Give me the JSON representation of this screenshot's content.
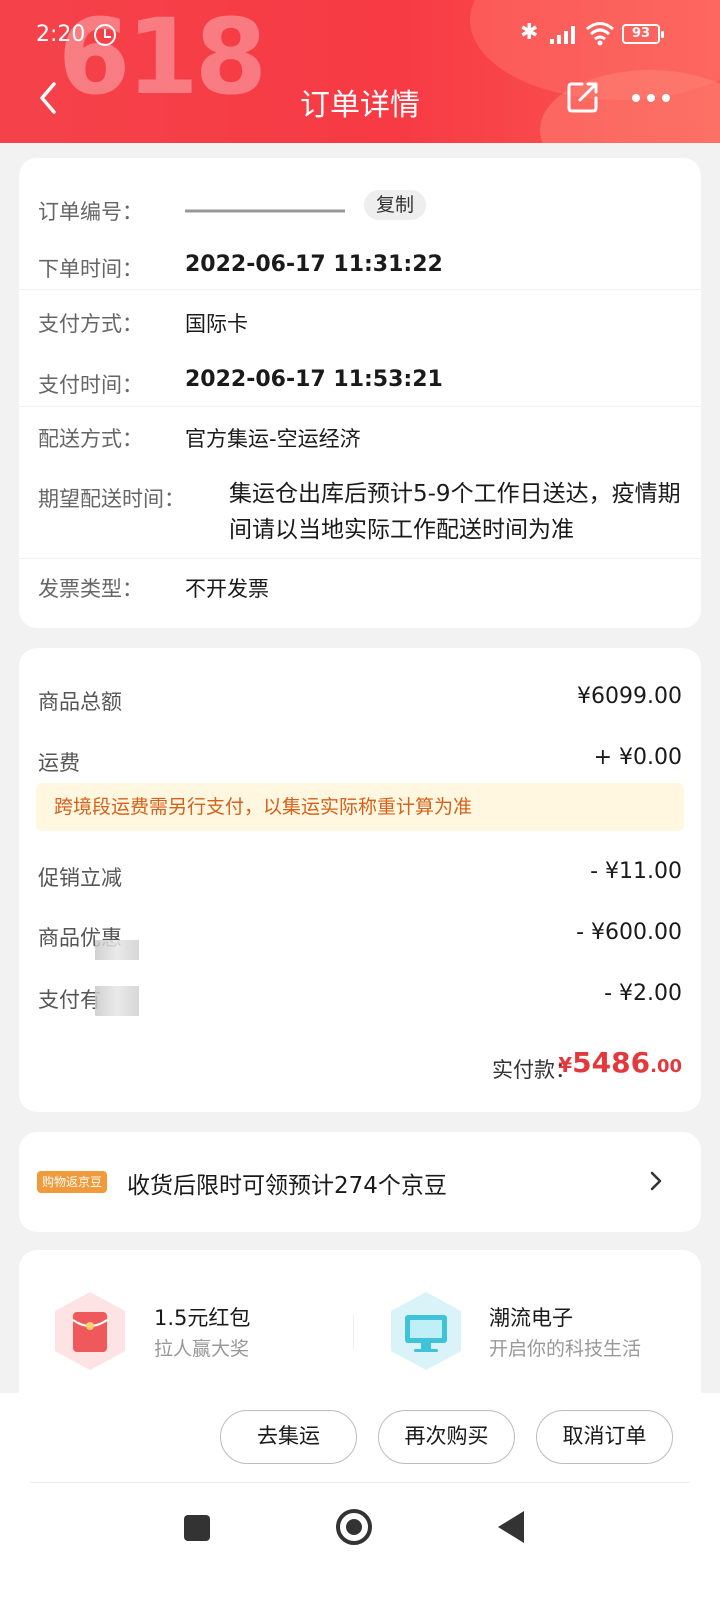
{
  "status_bar": {
    "time": "2:20",
    "battery": "93"
  },
  "header": {
    "watermark": "618",
    "title": "订单详情",
    "icons": [
      "back-icon",
      "share-icon",
      "more-icon"
    ]
  },
  "order": {
    "order_no_label": "订单编号：",
    "copy_label": "复制",
    "order_time_label": "下单时间：",
    "order_time": "2022-06-17 11:31:22",
    "pay_method_label": "支付方式：",
    "pay_method": "国际卡",
    "pay_time_label": "支付时间：",
    "pay_time": "2022-06-17 11:53:21",
    "delivery_label": "配送方式：",
    "delivery": "官方集运-空运经济",
    "expected_label": "期望配送时间：",
    "expected": "集运仓出库后预计5-9个工作日送达，疫情期间请以当地实际工作配送时间为准",
    "invoice_label": "发票类型：",
    "invoice": "不开发票"
  },
  "price": {
    "goods_total_label": "商品总额",
    "goods_total": "¥6099.00",
    "shipping_label": "运费",
    "shipping": "+ ¥0.00",
    "notice": "跨境段运费需另行支付，以集运实际称重计算为准",
    "promo_label": "促销立减",
    "promo": "- ¥11.00",
    "goods_discount_label": "商品优惠",
    "goods_discount": "- ¥600.00",
    "pay_discount_label": "支付有",
    "pay_discount": "- ¥2.00",
    "paid_label": "实付款：",
    "paid_symbol": "¥",
    "paid_int": "5486",
    "paid_dec": ".00"
  },
  "jd_bean": {
    "badge": "购物返京豆",
    "text": "收货后限时可领预计274个京豆"
  },
  "promos": [
    {
      "title": "1.5元红包",
      "subtitle": "拉人赢大奖"
    },
    {
      "title": "潮流电子",
      "subtitle": "开启你的科技生活"
    }
  ],
  "actions": {
    "consolidate": "去集运",
    "rebuy": "再次购买",
    "cancel": "取消订单"
  },
  "colors": {
    "header_red": "#f5424a",
    "price_red": "#e4393c",
    "notice_bg": "#fff7e0",
    "notice_text": "#d6611c",
    "badge_orange": "#f09a3a"
  }
}
